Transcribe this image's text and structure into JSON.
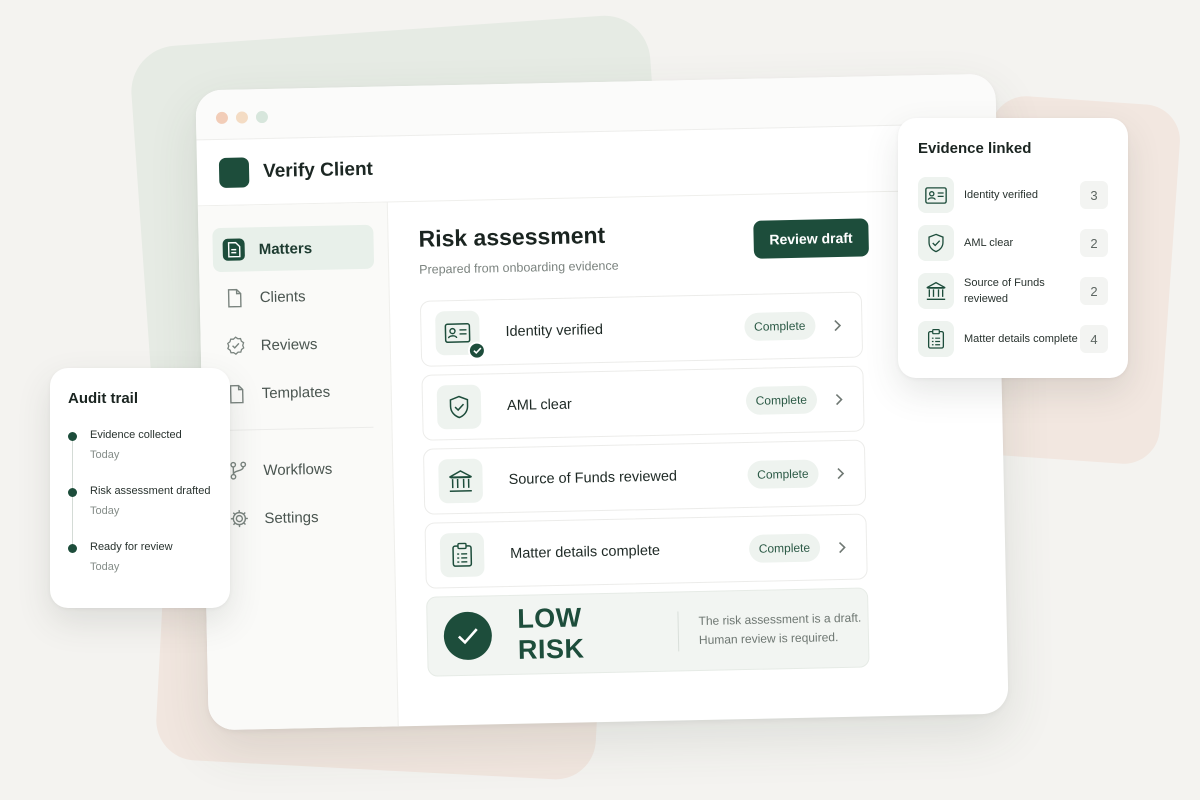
{
  "app": {
    "title": "Verify Client"
  },
  "sidebar": {
    "items": [
      {
        "label": "Matters",
        "icon": "document-icon",
        "active": true
      },
      {
        "label": "Clients",
        "icon": "file-icon"
      },
      {
        "label": "Reviews",
        "icon": "badge-check-icon"
      },
      {
        "label": "Templates",
        "icon": "file-icon"
      },
      {
        "label": "Workflows",
        "icon": "workflow-icon"
      },
      {
        "label": "Settings",
        "icon": "gear-icon"
      }
    ]
  },
  "main": {
    "title": "Risk assessment",
    "subtitle": "Prepared from onboarding evidence",
    "review_button": "Review draft",
    "rows": [
      {
        "label": "Identity verified",
        "status": "Complete",
        "icon": "id-card-icon"
      },
      {
        "label": "AML clear",
        "status": "Complete",
        "icon": "shield-check-icon"
      },
      {
        "label": "Source of Funds reviewed",
        "status": "Complete",
        "icon": "bank-icon"
      },
      {
        "label": "Matter details complete",
        "status": "Complete",
        "icon": "clipboard-icon"
      }
    ],
    "risk": {
      "label": "LOW RISK",
      "note": "The risk assessment is a draft. Human review is required."
    }
  },
  "audit": {
    "title": "Audit trail",
    "items": [
      {
        "label": "Evidence collected",
        "time": "Today"
      },
      {
        "label": "Risk assessment drafted",
        "time": "Today"
      },
      {
        "label": "Ready for review",
        "time": "Today"
      }
    ]
  },
  "evidence": {
    "title": "Evidence linked",
    "items": [
      {
        "label": "Identity verified",
        "count": "3"
      },
      {
        "label": "AML clear",
        "count": "2"
      },
      {
        "label": "Source of Funds reviewed",
        "count": "2"
      },
      {
        "label": "Matter details complete",
        "count": "4"
      }
    ]
  },
  "colors": {
    "accent": "#1d4d3b",
    "accent_soft": "#eef3ef",
    "background": "#f4f3f0"
  }
}
